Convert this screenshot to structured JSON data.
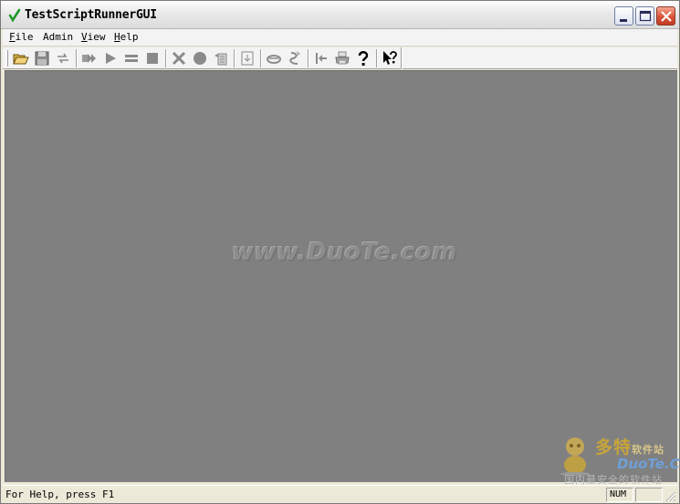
{
  "window": {
    "title": "TestScriptRunnerGUI"
  },
  "menu": {
    "file": {
      "key": "F",
      "rest": "ile"
    },
    "admin": {
      "key": "",
      "rest": "Admin"
    },
    "view": {
      "key": "V",
      "rest": "iew"
    },
    "help": {
      "key": "H",
      "rest": "elp"
    }
  },
  "toolbar": {
    "icons": [
      "open-folder-icon",
      "save-icon",
      "refresh-icon",
      "run-all-icon",
      "play-icon",
      "pause-icon",
      "stop-icon",
      "delete-icon",
      "record-icon",
      "properties-icon",
      "download-icon",
      "link-icon",
      "script-icon",
      "goto-first-icon",
      "print-icon",
      "help-icon",
      "context-help-icon"
    ]
  },
  "watermark": {
    "center": "www.DuoTe.com",
    "logo_cn_big": "多特",
    "logo_cn_small": "软件站",
    "logo_en": "DuoTe.Com",
    "logo_tagline": "国内最安全的软件站"
  },
  "statusbar": {
    "text": "For Help, press F1",
    "num": "NUM"
  },
  "colors": {
    "client_background": "#808080",
    "chrome": "#ece9d8",
    "close_button": "#d9533a"
  }
}
